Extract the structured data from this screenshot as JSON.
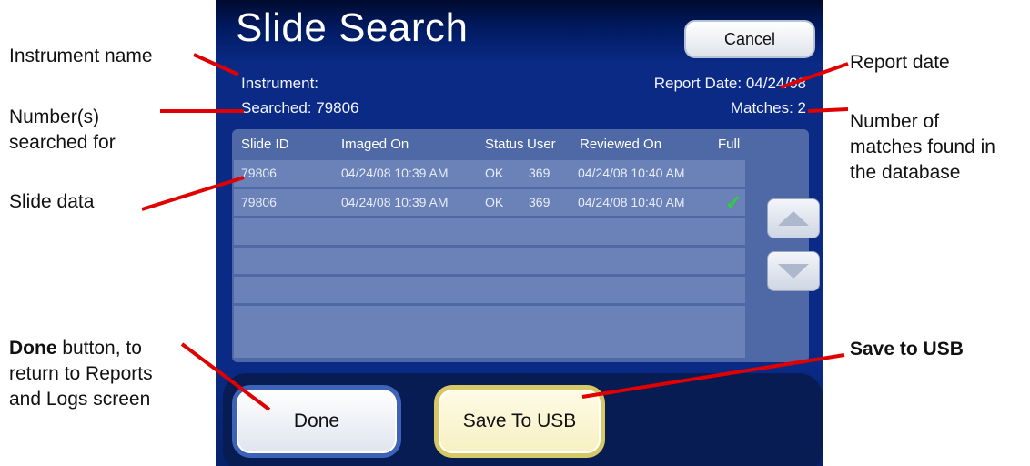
{
  "annotations": {
    "instrument_name": "Instrument name",
    "numbers_searched_line1": "Number(s)",
    "numbers_searched_line2": "searched for",
    "slide_data": "Slide data",
    "done_bold": "Done",
    "done_rest_line1": " button, to",
    "done_line2": "return to Reports",
    "done_line3": "and Logs screen",
    "report_date": "Report date",
    "matches_line1": "Number of",
    "matches_line2": "matches found in",
    "matches_line3": "the database",
    "save_usb": "Save to USB"
  },
  "screen": {
    "title": "Slide Search",
    "cancel_label": "Cancel",
    "instrument_label": "Instrument:",
    "searched_text": "Searched: 79806",
    "report_date_text": "Report Date: 04/24/08",
    "matches_text": "Matches: 2",
    "columns": {
      "slide_id": "Slide ID",
      "imaged_on": "Imaged On",
      "status": "Status",
      "user": "User",
      "reviewed_on": "Reviewed On",
      "full": "Full"
    },
    "rows": [
      {
        "slide_id": "79806",
        "imaged_on": "04/24/08  10:39 AM",
        "status": "OK",
        "user": "369",
        "reviewed_on": "04/24/08  10:40 AM",
        "full": ""
      },
      {
        "slide_id": "79806",
        "imaged_on": "04/24/08  10:39 AM",
        "status": "OK",
        "user": "369",
        "reviewed_on": "04/24/08  10:40 AM",
        "full": "✓"
      }
    ],
    "done_label": "Done",
    "save_usb_label": "Save To USB"
  },
  "colors": {
    "screen_bg": "#0a2a86",
    "panel_bg": "#4e69a6",
    "row_bg": "#6a82b7",
    "check": "#2ad13a",
    "done_border": "#3d63b8",
    "usb_border": "#d7c866",
    "callout_line": "#e00000"
  },
  "icons": {
    "scroll_up": "triangle-up-icon",
    "scroll_down": "triangle-down-icon",
    "full_check": "checkmark-icon"
  }
}
